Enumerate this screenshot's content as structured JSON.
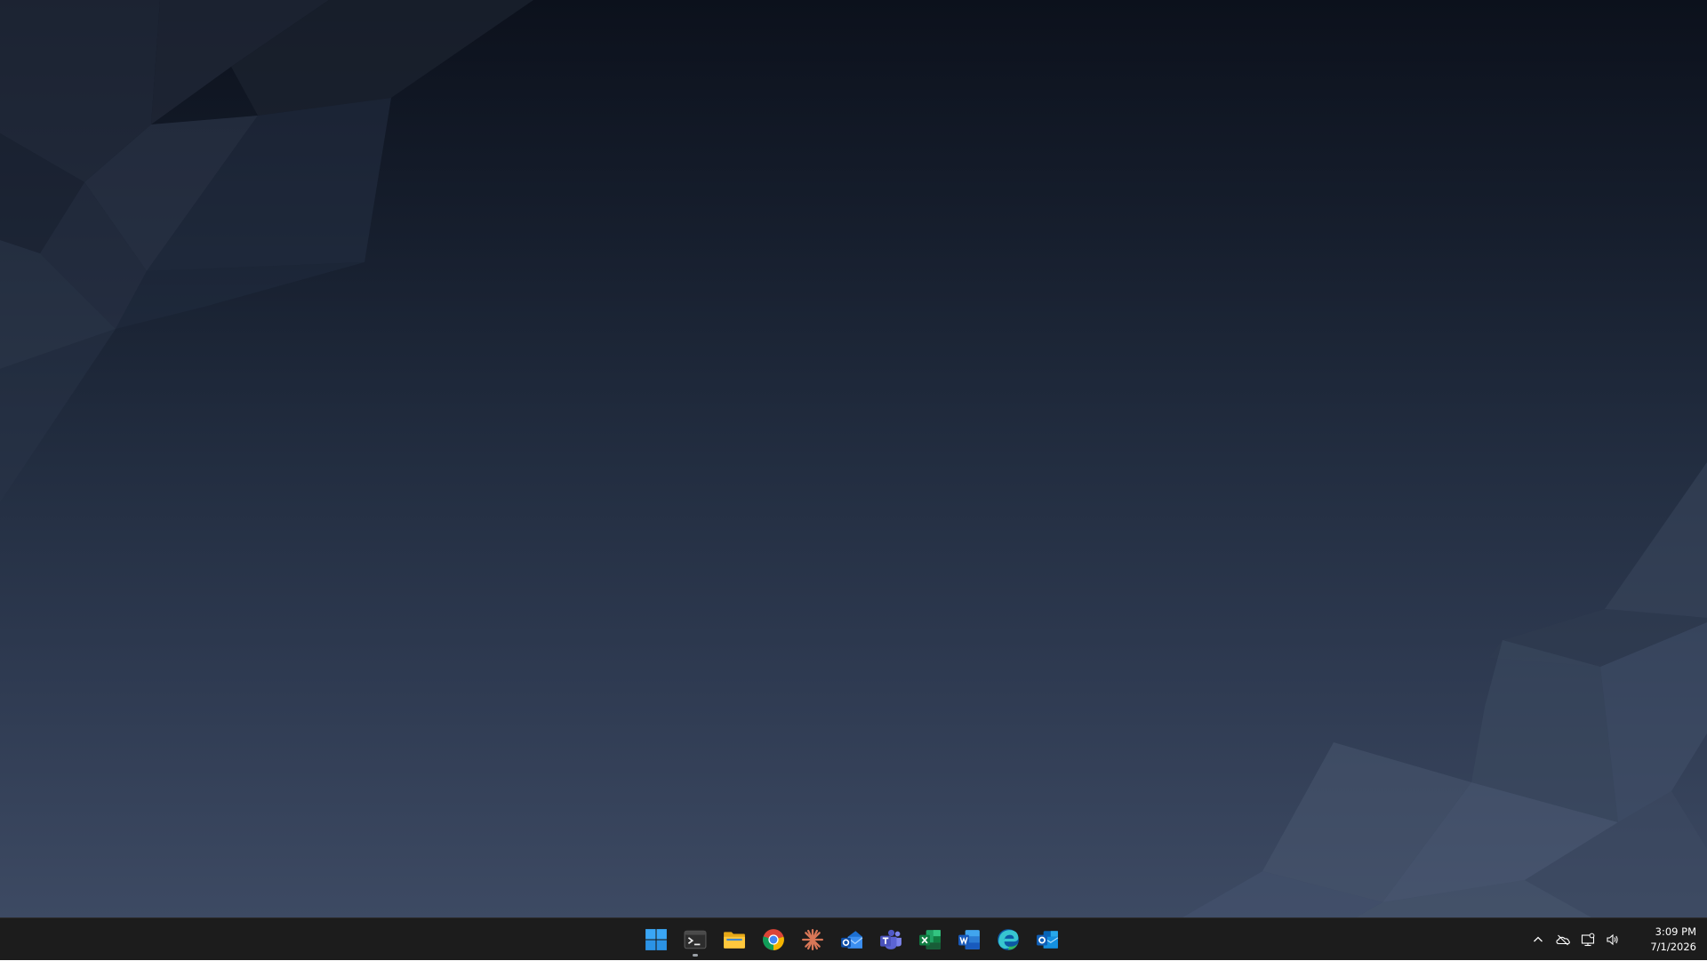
{
  "desktop": {
    "wallpaper": "dark-blue-low-poly-gradient"
  },
  "taskbar": {
    "apps": [
      {
        "id": "start",
        "icon": "windows-start-icon",
        "running": false
      },
      {
        "id": "terminal",
        "icon": "terminal-icon",
        "running": true
      },
      {
        "id": "file-explorer",
        "icon": "folder-icon",
        "running": false
      },
      {
        "id": "chrome",
        "icon": "chrome-icon",
        "running": false
      },
      {
        "id": "claude",
        "icon": "claude-sunburst-icon",
        "running": false
      },
      {
        "id": "outlook-new",
        "icon": "outlook-new-icon",
        "running": false
      },
      {
        "id": "teams",
        "icon": "teams-icon",
        "running": false
      },
      {
        "id": "excel",
        "icon": "excel-icon",
        "running": false
      },
      {
        "id": "word",
        "icon": "word-icon",
        "running": false
      },
      {
        "id": "edge",
        "icon": "edge-icon",
        "running": false
      },
      {
        "id": "outlook",
        "icon": "outlook-icon",
        "running": false
      }
    ],
    "tray": {
      "icons": [
        "chevron-up-icon",
        "onedrive-icon",
        "network-icon",
        "volume-icon"
      ],
      "clock": {
        "time": "3:09 PM",
        "date": "7/1/2026"
      }
    }
  },
  "colors": {
    "taskbar_bg": "#1c1c1c",
    "windows_blue": "#39a0f2",
    "excel_green": "#1f8f4a",
    "word_blue": "#2b6fd6",
    "claude_orange": "#d97757"
  }
}
